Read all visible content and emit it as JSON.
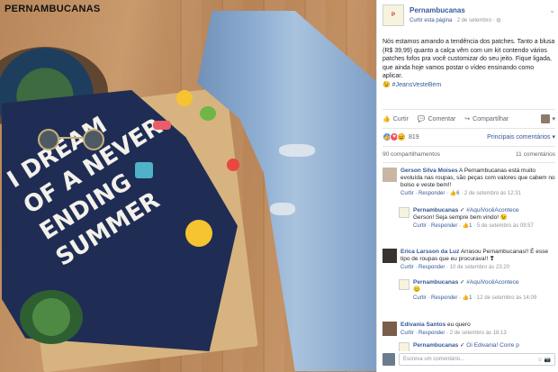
{
  "brand": {
    "logo_text": "PERNAMBUCANAS"
  },
  "photo": {
    "shirt_lines": [
      "I DREAM",
      "OF A NEVER",
      "ENDING",
      "SUMMER"
    ]
  },
  "post": {
    "page_name": "Pernambucanas",
    "like_page": "Curtir esta página",
    "date": "2 de setembro",
    "privacy_icon": "globe-icon",
    "text": "Nós estamos amando a tendência dos patches. Tanto a blusa (R$ 39,99) quanto a calça vêm com um kit contendo vários patches fofos pra você customizar do seu jeito. Fique ligada, que ainda hoje vamos postar o vídeo ensinando como aplicar.",
    "hashtag": "#JeansVesteBem"
  },
  "actions": {
    "like": "Curtir",
    "comment": "Comentar",
    "share": "Compartilhar"
  },
  "reactions": {
    "count": "819",
    "sort_label": "Principais comentários"
  },
  "stats": {
    "shares": "90 compartilhamentos",
    "comments": "11 comentários"
  },
  "comments": [
    {
      "name": "Gerson Silva Moises",
      "text": "A Pernambucanas está muito evoluída nas roupas, são peças com valores que cabem no bolso e veste bem!!",
      "reply_label": "Curtir · Responder ·",
      "likes": "6",
      "time": "· 2 de setembro às 12:31"
    },
    {
      "name": "Pernambucanas",
      "tag": "#AquiVocêAcontece",
      "text": "Gerson! Seja sempre bem vindo!",
      "reply_label": "Curtir · Responder ·",
      "likes": "1",
      "time": "· 5 de setembro às 09:57"
    },
    {
      "name": "Erica Larsson da Luz",
      "text": "Arrasou Pernambucanas!! É esse tipo de roupas que eu procurava!!",
      "reply_label": "Curtir · Responder ·",
      "time": "10 de setembro às 23:20"
    },
    {
      "name": "Pernambucanas",
      "tag": "#AquiVocêAcontece",
      "text": "",
      "reply_label": "Curtir · Responder ·",
      "likes": "1",
      "time": "· 12 de setembro às 14:09"
    },
    {
      "name": "Edivania Santos",
      "text": "eu quero",
      "reply_label": "Curtir · Responder ·",
      "time": "2 de setembro às 18:13"
    },
    {
      "name": "Pernambucanas",
      "tag": "Oi Edivania! Corre p",
      "text": ""
    }
  ],
  "write": {
    "placeholder": "Escreva um comentário..."
  }
}
